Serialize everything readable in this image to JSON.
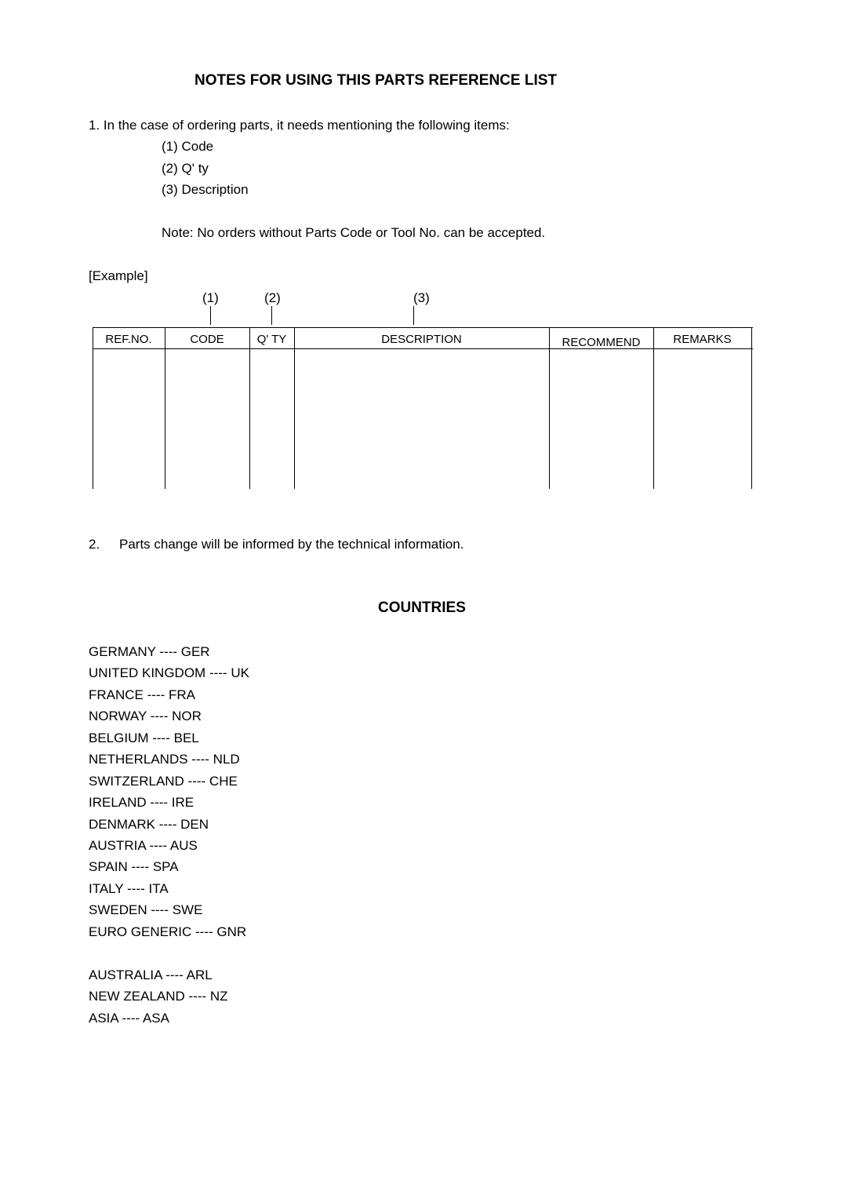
{
  "notes": {
    "title": "NOTES FOR USING THIS PARTS REFERENCE LIST",
    "item1_intro": "1. In the case of ordering parts, it needs mentioning the following items:",
    "order_items": [
      "(1) Code",
      "(2) Q' ty",
      "(3) Description"
    ],
    "note": "Note: No orders without Parts Code or Tool No. can be accepted.",
    "example_label": "[Example]",
    "markers": [
      "(1)",
      "(2)",
      "(3)"
    ],
    "table_headers": [
      "REF.NO.",
      "CODE",
      "Q' TY",
      "DESCRIPTION",
      "RECOMMEND",
      "REMARKS"
    ],
    "item2_number": "2.",
    "item2_text": "Parts change will be informed by the technical information."
  },
  "countries": {
    "title": "COUNTRIES",
    "europe": [
      "GERMANY ---- GER",
      "UNITED KINGDOM ---- UK",
      "FRANCE ---- FRA",
      "NORWAY ---- NOR",
      "BELGIUM ---- BEL",
      "NETHERLANDS ---- NLD",
      "SWITZERLAND ---- CHE",
      "IRELAND ---- IRE",
      "DENMARK ---- DEN",
      "AUSTRIA ---- AUS",
      "SPAIN ---- SPA",
      "ITALY ---- ITA",
      "SWEDEN ---- SWE",
      "EURO GENERIC ---- GNR"
    ],
    "other": [
      "AUSTRALIA ---- ARL",
      "NEW ZEALAND ---- NZ",
      "ASIA ---- ASA"
    ]
  }
}
